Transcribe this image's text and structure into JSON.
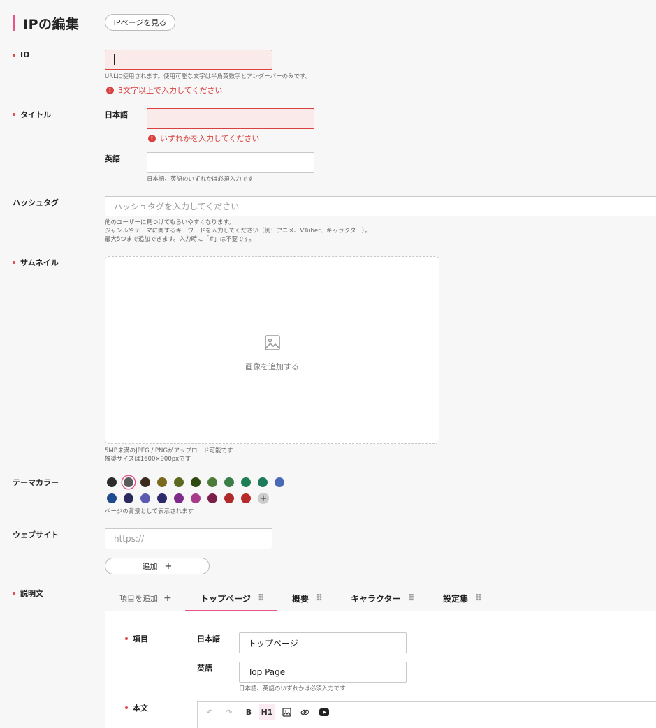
{
  "header": {
    "title": "IPの編集",
    "view_button": "IPページを見る"
  },
  "id_field": {
    "label": "ID",
    "value": "",
    "help": "URLに使用されます。使用可能な文字は半角英数字とアンダーバーのみです。",
    "error": "3文字以上で入力してください"
  },
  "title_field": {
    "label": "タイトル",
    "ja_label": "日本語",
    "ja_value": "",
    "ja_error": "いずれかを入力してください",
    "en_label": "英語",
    "en_value": "",
    "help": "日本語、英語のいずれかは必須入力です"
  },
  "hashtag_field": {
    "label": "ハッシュタグ",
    "placeholder": "ハッシュタグを入力してください",
    "help1": "他のユーザーに見つけてもらいやすくなります。",
    "help2": "ジャンルやテーマに関するキーワードを入力してください（例：アニメ、VTuber、キャラクター）。",
    "help3": "最大5つまで追加できます。入力時に「#」は不要です。"
  },
  "thumbnail_field": {
    "label": "サムネイル",
    "drop_text": "画像を追加する",
    "help1": "5MB未満のJPEG / PNGがアップロード可能です",
    "help2": "推奨サイズは1600×900pxです"
  },
  "theme_color_field": {
    "label": "テーマカラー",
    "help": "ページの背景として表示されます",
    "colors_row1": [
      "#2c2c2c",
      "#5a5a5a",
      "#3a2a1e",
      "#7a6a1e",
      "#5a6a1e",
      "#2e4a10",
      "#4e7a3a",
      "#3a7e4a",
      "#1e7e54",
      "#1e7a5a",
      "#4a6ab8"
    ],
    "colors_row2": [
      "#1e4a8e",
      "#2a2a5e",
      "#5a5ab0",
      "#2e2a6a",
      "#7e2a8a",
      "#a83a8a",
      "#7a1e4a",
      "#b02a2a",
      "#b82a2a"
    ],
    "selected_index": 1,
    "add_symbol": "+"
  },
  "website_field": {
    "label": "ウェブサイト",
    "placeholder": "https://",
    "add_button": "追加"
  },
  "description_field": {
    "label": "説明文",
    "add_item": "項目を追加",
    "tabs": [
      "トップページ",
      "概要",
      "キャラクター",
      "設定集"
    ],
    "active_tab_index": 0,
    "item_label": "項目",
    "item_ja_label": "日本語",
    "item_ja_value": "トップページ",
    "item_en_label": "英語",
    "item_en_value": "Top Page",
    "item_help": "日本語、英語のいずれかは必須入力です",
    "body_label": "本文",
    "toolbar": {
      "bold": "B",
      "heading": "H1"
    }
  }
}
